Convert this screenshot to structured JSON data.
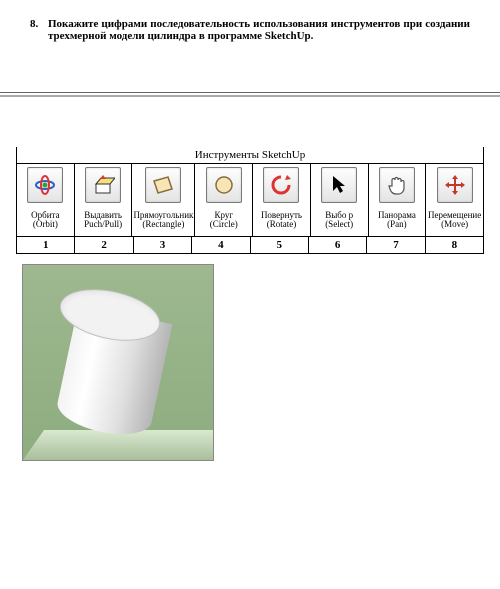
{
  "question": {
    "number": "8.",
    "text": "Покажите цифрами последовательность использования инструментов при создании трехмерной модели цилиндра в программе SketchUp."
  },
  "tools": {
    "title": "Инструменты SketchUp",
    "items": [
      {
        "label": "Орбита (Orbit)",
        "icon": "orbit-icon",
        "number": "1"
      },
      {
        "label": "Выдавить\nPuch/Pull)",
        "icon": "pushpull-icon",
        "number": "2"
      },
      {
        "label": "Прямоугольник\n(Rectangle)",
        "icon": "rectangle-icon",
        "number": "3"
      },
      {
        "label": "Круг\n(Circle)",
        "icon": "circle-icon",
        "number": "4"
      },
      {
        "label": "Повернуть\n(Rotate)",
        "icon": "rotate-icon",
        "number": "5"
      },
      {
        "label": "Выбо р\n(Select)",
        "icon": "select-icon",
        "number": "6"
      },
      {
        "label": "Панорама\n(Pan)",
        "icon": "pan-icon",
        "number": "7"
      },
      {
        "label": "Перемещение\n(Move)",
        "icon": "move-icon",
        "number": "8"
      }
    ]
  }
}
